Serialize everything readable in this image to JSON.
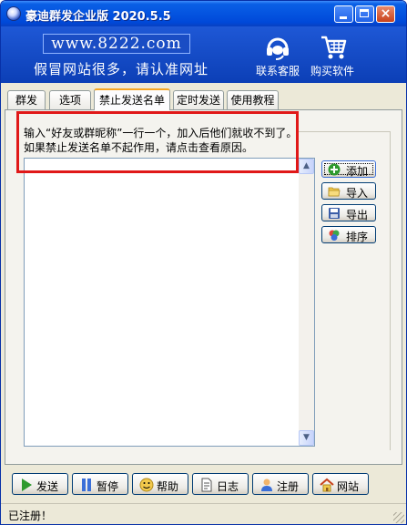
{
  "window": {
    "title": "豪迪群发企业版 2020.5.5",
    "controls": {
      "minimize": "minimize",
      "maximize": "maximize",
      "close": "×"
    }
  },
  "banner": {
    "site": "www.8222.com",
    "slogan": "假冒网站很多，请认准网址",
    "service_label": "联系客服",
    "buy_label": "购买软件"
  },
  "tabs": [
    {
      "label": "群发",
      "active": false
    },
    {
      "label": "选项",
      "active": false
    },
    {
      "label": "禁止发送名单",
      "active": true
    },
    {
      "label": "定时发送",
      "active": false
    },
    {
      "label": "使用教程",
      "active": false
    }
  ],
  "blocklist": {
    "hint_line1": "输入“好友或群昵称”一行一个，加入后他们就收不到了。",
    "hint_line2": "如果禁止发送名单不起作用，请点击查看原因。",
    "list_value": "",
    "buttons": {
      "add": "添加",
      "import": "导入",
      "export": "导出",
      "sort": "排序"
    }
  },
  "bottom_buttons": {
    "send": "发送",
    "pause": "暂停",
    "help": "帮助",
    "log": "日志",
    "register": "注册",
    "website": "网站"
  },
  "status": {
    "text": "已注册！"
  },
  "colors": {
    "accent_red": "#e01818",
    "titlebar": "#0454e0",
    "banner": "#1a4dc4"
  }
}
